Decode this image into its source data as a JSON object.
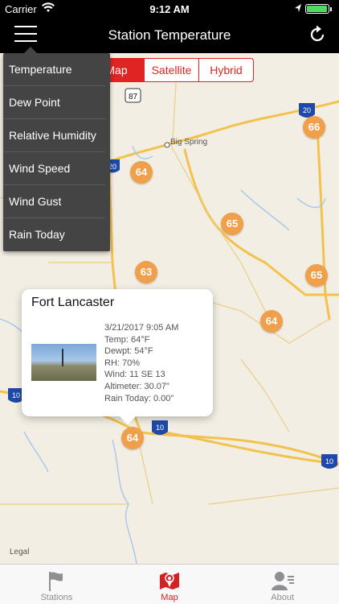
{
  "status": {
    "carrier": "Carrier",
    "time": "9:12 AM",
    "battery": 0.95
  },
  "nav": {
    "title": "Station Temperature"
  },
  "map_types": [
    "Map",
    "Satellite",
    "Hybrid"
  ],
  "menu": {
    "items": [
      {
        "label": "Temperature"
      },
      {
        "label": "Dew Point"
      },
      {
        "label": "Relative Humidity"
      },
      {
        "label": "Wind Speed"
      },
      {
        "label": "Wind Gust"
      },
      {
        "label": "Rain Today"
      }
    ]
  },
  "map": {
    "city": "Big Spring",
    "shields": {
      "us87": "87",
      "i20a": "20",
      "i20b": "20",
      "i10a": "10",
      "i10b": "10",
      "i10c": "10"
    },
    "legal": "Legal",
    "markers": [
      "66",
      "64",
      "65",
      "63",
      "65",
      "64",
      "64"
    ]
  },
  "callout": {
    "title": "Fort Lancaster",
    "datetime": "3/21/2017 9:05 AM",
    "temp": "Temp: 64°F",
    "dewpt": "Dewpt: 54°F",
    "rh": "RH: 70%",
    "wind": "Wind: 11 SE 13",
    "altimeter": "Altimeter: 30.07\"",
    "rain": "Rain Today: 0.00\""
  },
  "tabs": [
    {
      "label": "Stations",
      "icon": "flag-icon",
      "active": false
    },
    {
      "label": "Map",
      "icon": "map-icon",
      "active": true
    },
    {
      "label": "About",
      "icon": "person-icon",
      "active": false
    }
  ],
  "colors": {
    "accent": "#e02424",
    "marker": "#f0a04b",
    "menu_bg": "#444444"
  }
}
